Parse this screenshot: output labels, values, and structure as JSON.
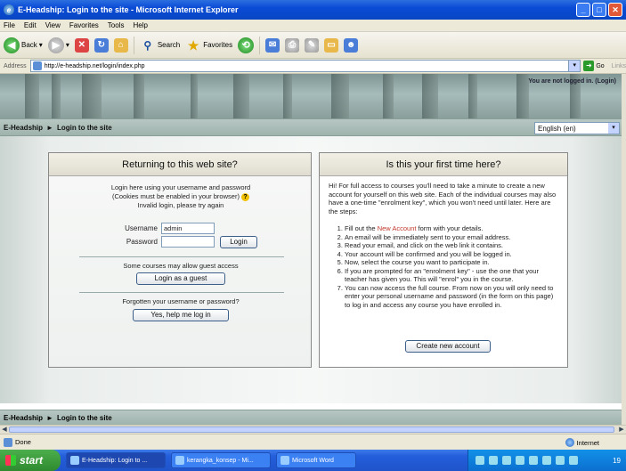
{
  "window": {
    "title": "E-Headship: Login to the site - Microsoft Internet Explorer",
    "controls": [
      "_",
      "□",
      "✕"
    ]
  },
  "menu": [
    "File",
    "Edit",
    "View",
    "Favorites",
    "Tools",
    "Help"
  ],
  "toolbar": {
    "back_label": "Back",
    "search_label": "Search",
    "favorites_label": "Favorites"
  },
  "address": {
    "label": "Address",
    "url": "http://e-headship.net/login/index.php",
    "go_label": "Go",
    "links_label": "Links"
  },
  "page": {
    "login_status": "You are not logged in. (Login)",
    "breadcrumb_site": "E-Headship",
    "breadcrumb_sep": "►",
    "breadcrumb_page": "Login to the site",
    "language": "English (en)",
    "left": {
      "heading": "Returning to this web site?",
      "intro_line1": "Login here using your username and password",
      "intro_line2": "(Cookies must be enabled in your browser)",
      "error": "Invalid login, please try again",
      "username_label": "Username",
      "username_value": "admin",
      "password_label": "Password",
      "password_value": "",
      "login_button": "Login",
      "guest_text": "Some courses may allow guest access",
      "guest_button": "Login as a guest",
      "forgot_text": "Forgotten your username or password?",
      "forgot_button": "Yes, help me log in"
    },
    "right": {
      "heading": "Is this your first time here?",
      "intro": "Hi! For full access to courses you'll need to take a minute to create a new account for yourself on this web site. Each of the individual courses may also have a one-time \"enrolment key\", which you won't need until later. Here are the steps:",
      "step1_pre": "Fill out the ",
      "step1_link": "New Account",
      "step1_post": " form with your details.",
      "steps": [
        "An email will be immediately sent to your email address.",
        "Read your email, and click on the web link it contains.",
        "Your account will be confirmed and you will be logged in.",
        "Now, select the course you want to participate in.",
        "If you are prompted for an \"enrolment key\" - use the one that your teacher has given you. This will \"enrol\" you in the course.",
        "You can now access the full course. From now on you will only need to enter your personal username and password (in the form on this page) to log in and access any course you have enrolled in."
      ],
      "create_button": "Create new account"
    }
  },
  "status": {
    "text": "Done",
    "zone": "Internet"
  },
  "taskbar": {
    "start_label": "start",
    "tasks": [
      "E-Headship: Login to ...",
      "kerangka_konsep - Mi...",
      "Microsoft Word"
    ],
    "clock": "19"
  }
}
